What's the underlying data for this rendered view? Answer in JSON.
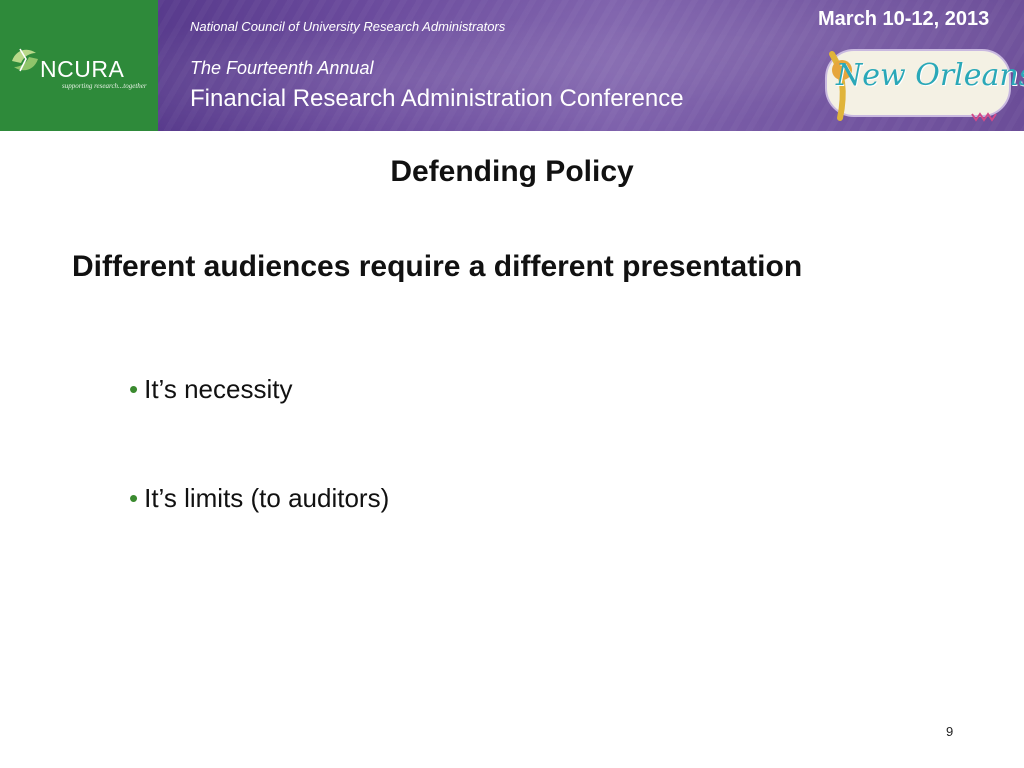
{
  "header": {
    "logo": {
      "name": "NCURA",
      "tagline": "supporting research...together",
      "brand_color": "#2e8a3a"
    },
    "organization": "National Council of University Research Administrators",
    "conference_line1": "The Fourteenth Annual",
    "conference_line2": "Financial Research Administration Conference",
    "dates": "March 10-12, 2013",
    "city_logo_text": "New Orleans",
    "banner_color": "#6a4a9c"
  },
  "slide": {
    "title": "Defending Policy",
    "subtitle": "Different audiences require a different presentation",
    "bullet_symbol": "•",
    "bullet_color": "#3a8a2f",
    "bullets": [
      "It’s necessity",
      "It’s limits (to auditors)"
    ],
    "page_number": "9"
  }
}
